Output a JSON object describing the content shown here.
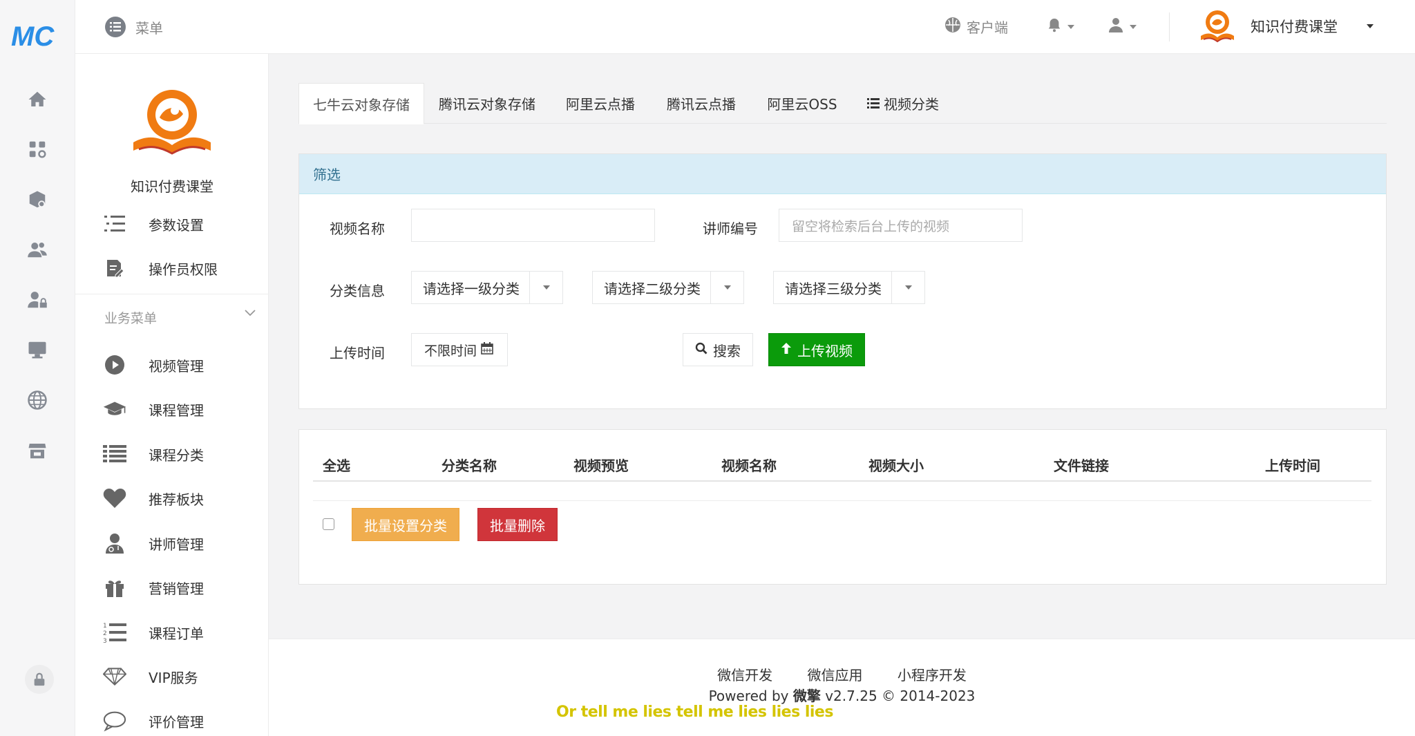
{
  "header": {
    "menu_label": "菜单",
    "client_label": "客户端",
    "user_name": "知识付费课堂"
  },
  "brand": {
    "name": "知识付费课堂"
  },
  "sidebar": {
    "settings_items": [
      {
        "label": "参数设置",
        "icon": "list-icon"
      },
      {
        "label": "操作员权限",
        "icon": "edit-doc-icon"
      }
    ],
    "group_label": "业务菜单",
    "business_items": [
      {
        "label": "视频管理",
        "icon": "play-circle-icon"
      },
      {
        "label": "课程管理",
        "icon": "graduation-cap-icon"
      },
      {
        "label": "课程分类",
        "icon": "list-icon"
      },
      {
        "label": "推荐板块",
        "icon": "heart-icon"
      },
      {
        "label": "讲师管理",
        "icon": "user-doctor-icon"
      },
      {
        "label": "营销管理",
        "icon": "gift-icon"
      },
      {
        "label": "课程订单",
        "icon": "ordered-list-icon"
      },
      {
        "label": "VIP服务",
        "icon": "diamond-icon"
      },
      {
        "label": "评价管理",
        "icon": "comment-icon"
      }
    ]
  },
  "tabs": [
    {
      "label": "七牛云对象存储",
      "active": true
    },
    {
      "label": "腾讯云对象存储"
    },
    {
      "label": "阿里云点播"
    },
    {
      "label": "腾讯云点播"
    },
    {
      "label": "阿里云OSS"
    },
    {
      "label": "视频分类",
      "icon": "list-icon"
    }
  ],
  "filter": {
    "title": "筛选",
    "video_name_label": "视频名称",
    "video_name_value": "",
    "teacher_label": "讲师编号",
    "teacher_placeholder": "留空将检索后台上传的视频",
    "category_label": "分类信息",
    "category1": "请选择一级分类",
    "category2": "请选择二级分类",
    "category3": "请选择三级分类",
    "time_label": "上传时间",
    "time_value": "不限时间",
    "search_button": "搜索",
    "upload_button": "上传视频"
  },
  "table": {
    "columns": [
      "全选",
      "分类名称",
      "视频预览",
      "视频名称",
      "视频大小",
      "文件链接",
      "上传时间"
    ],
    "batch_category_button": "批量设置分类",
    "batch_delete_button": "批量删除"
  },
  "footer": {
    "links": [
      "微信开发",
      "微信应用",
      "小程序开发"
    ],
    "powered_prefix": "Powered by ",
    "powered_brand": "微擎",
    "powered_suffix": " v2.7.25 © 2014-2023"
  },
  "subtitle": "Or tell me lies tell me lies lies lies",
  "colors": {
    "accent_green": "#0b9b0b",
    "warning_orange": "#f0ad4e",
    "danger_red": "#d0353b",
    "info_bg": "#d9edf7",
    "logo_orange": "#f07b12"
  }
}
